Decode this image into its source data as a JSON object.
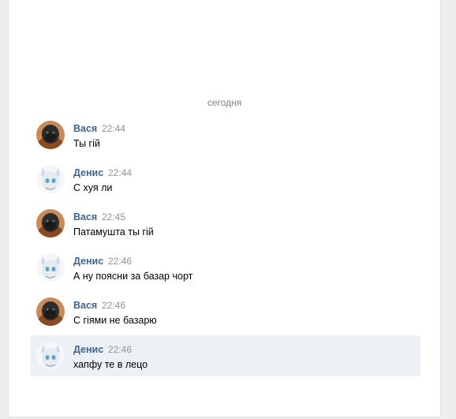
{
  "date_separator": "сегодня",
  "messages": [
    {
      "author": "Вася",
      "time": "22:44",
      "text": "Ты гій",
      "avatar": "vasya-avatar",
      "selected": false
    },
    {
      "author": "Денис",
      "time": "22:44",
      "text": "С хуя ли",
      "avatar": "denis-avatar",
      "selected": false
    },
    {
      "author": "Вася",
      "time": "22:45",
      "text": "Патамушта ты гій",
      "avatar": "vasya-avatar",
      "selected": false
    },
    {
      "author": "Денис",
      "time": "22:46",
      "text": "А ну поясни за базар чорт",
      "avatar": "denis-avatar",
      "selected": false
    },
    {
      "author": "Вася",
      "time": "22:46",
      "text": "С гіями не базарю",
      "avatar": "vasya-avatar",
      "selected": false
    },
    {
      "author": "Денис",
      "time": "22:46",
      "text": "хапфу те в лецо",
      "avatar": "denis-avatar",
      "selected": true
    }
  ],
  "colors": {
    "author_name": "#42648b",
    "timestamp": "#939393",
    "selected_row": "#edf0f5",
    "page_background": "#edeef0"
  }
}
